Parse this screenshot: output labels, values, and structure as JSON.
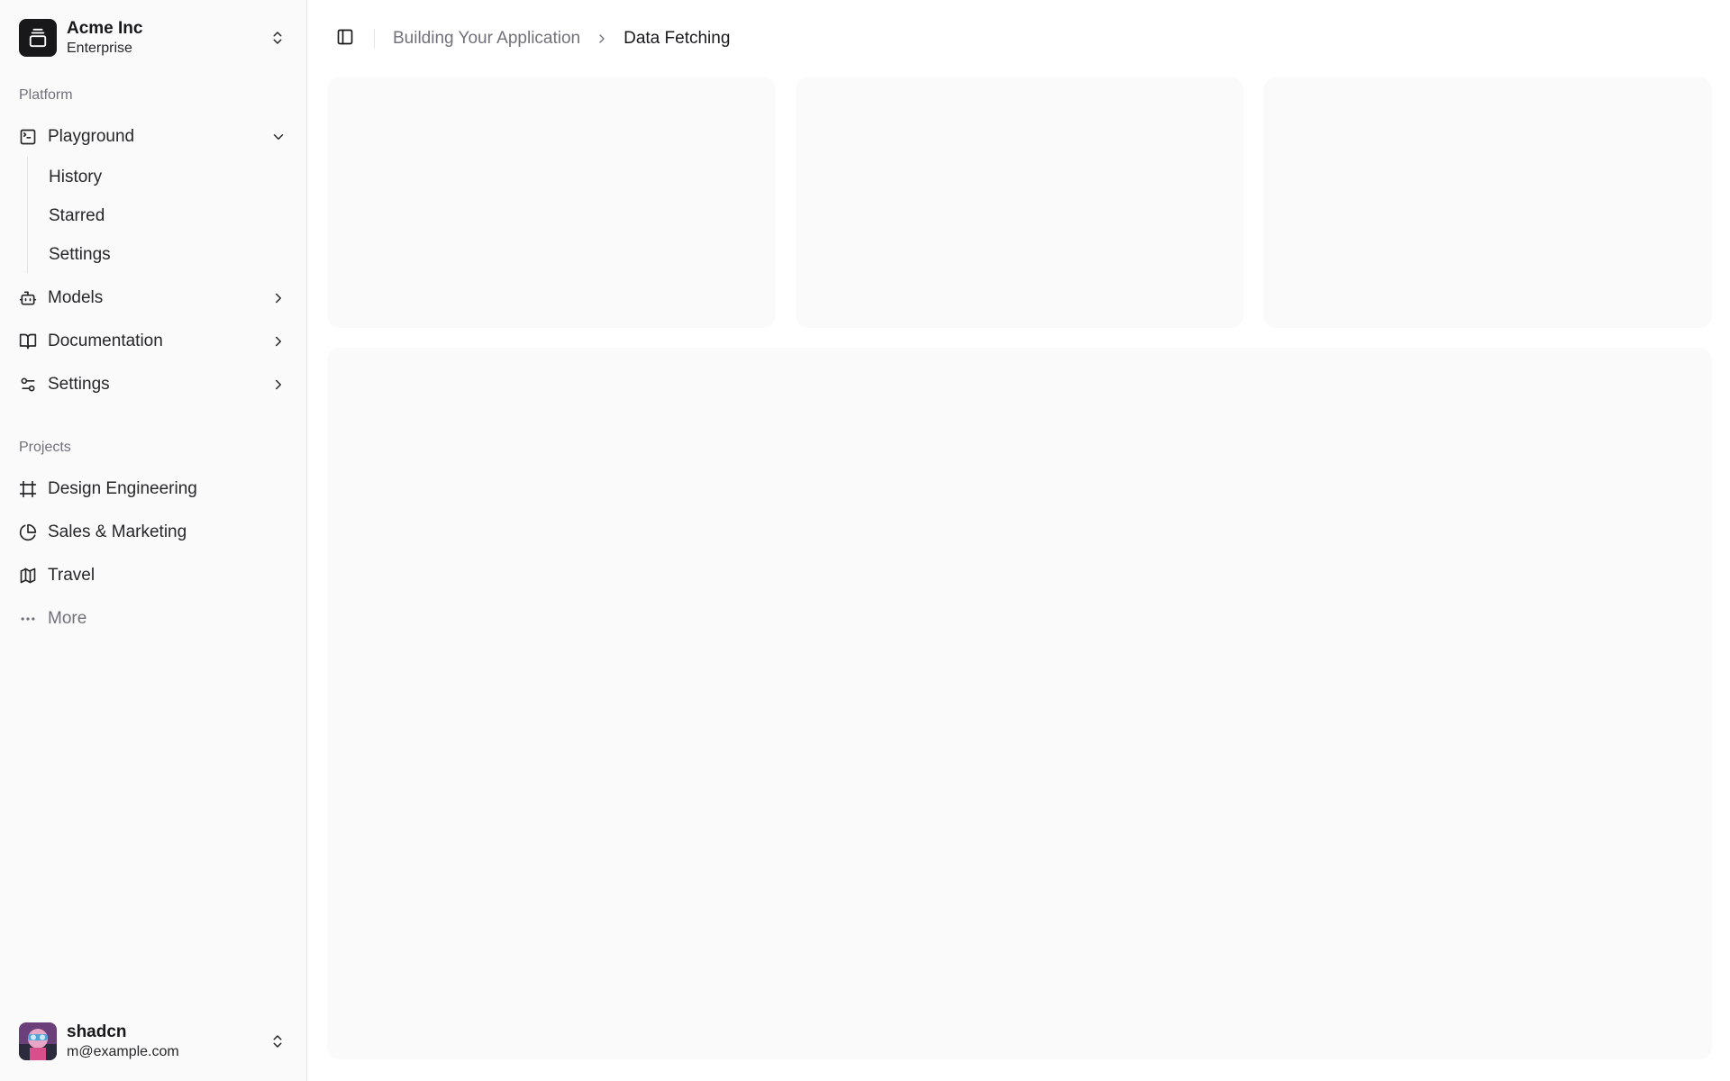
{
  "team": {
    "name": "Acme Inc",
    "plan": "Enterprise",
    "logo_icon": "gallery-vertical-end-icon"
  },
  "sidebar": {
    "platform_label": "Platform",
    "platform_items": [
      {
        "label": "Playground",
        "icon": "square-terminal-icon",
        "expanded": true,
        "children": [
          {
            "label": "History"
          },
          {
            "label": "Starred"
          },
          {
            "label": "Settings"
          }
        ]
      },
      {
        "label": "Models",
        "icon": "bot-icon"
      },
      {
        "label": "Documentation",
        "icon": "book-open-icon"
      },
      {
        "label": "Settings",
        "icon": "settings-2-icon"
      }
    ],
    "projects_label": "Projects",
    "project_items": [
      {
        "label": "Design Engineering",
        "icon": "frame-icon"
      },
      {
        "label": "Sales & Marketing",
        "icon": "pie-chart-icon"
      },
      {
        "label": "Travel",
        "icon": "map-icon"
      },
      {
        "label": "More",
        "icon": "more-horizontal-icon"
      }
    ]
  },
  "user": {
    "name": "shadcn",
    "email": "m@example.com"
  },
  "breadcrumb": {
    "parent": "Building Your Application",
    "current": "Data Fetching"
  },
  "colors": {
    "sidebar_bg": "#fafafa",
    "placeholder_bg": "#fafafa",
    "text_primary": "#18181b",
    "text_muted": "#71717a",
    "border": "#e4e4e7"
  }
}
